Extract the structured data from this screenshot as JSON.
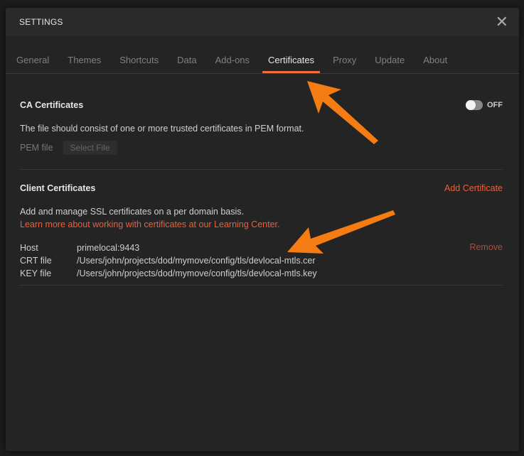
{
  "dialog": {
    "title": "SETTINGS"
  },
  "tabs": [
    "General",
    "Themes",
    "Shortcuts",
    "Data",
    "Add-ons",
    "Certificates",
    "Proxy",
    "Update",
    "About"
  ],
  "active_tab": "Certificates",
  "ca": {
    "title": "CA Certificates",
    "toggle": "OFF",
    "desc": "The file should consist of one or more trusted certificates in PEM format.",
    "pem_label": "PEM file",
    "select_file": "Select File"
  },
  "client": {
    "title": "Client Certificates",
    "add": "Add Certificate",
    "desc": "Add and manage SSL certificates on a per domain basis.",
    "learn": "Learn more about working with certificates at our Learning Center.",
    "cert": {
      "host_label": "Host",
      "host": "primelocal:9443",
      "crt_label": "CRT file",
      "crt": "/Users/john/projects/dod/mymove/config/tls/devlocal-mtls.cer",
      "key_label": "KEY file",
      "key": "/Users/john/projects/dod/mymove/config/tls/devlocal-mtls.key",
      "remove": "Remove"
    }
  },
  "colors": {
    "accent": "#f26b3a",
    "arrow": "#f57c12"
  }
}
